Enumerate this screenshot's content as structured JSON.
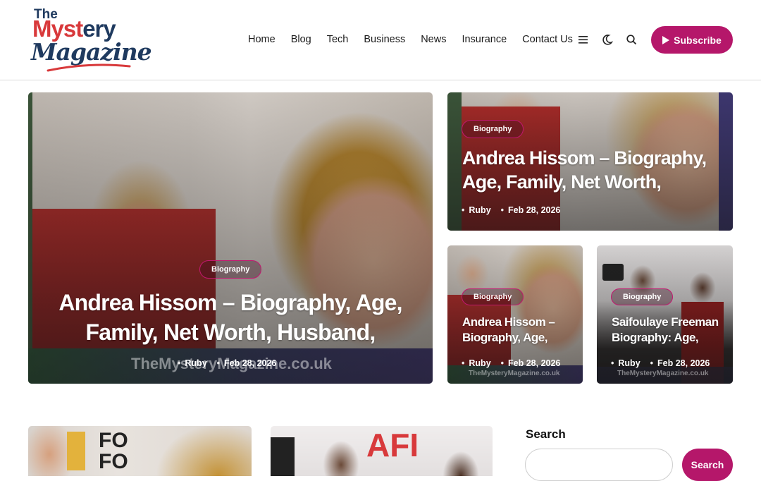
{
  "brand": {
    "logo_the": "The",
    "logo_mystery_red": "Myst",
    "logo_mystery_blue": "ery",
    "logo_magazine": "Magazine"
  },
  "nav": {
    "items": [
      "Home",
      "Blog",
      "Tech",
      "Business",
      "News",
      "Insurance",
      "Contact Us"
    ]
  },
  "header_icons": [
    "menu-icon",
    "moon-icon",
    "search-icon"
  ],
  "subscribe": {
    "label": "Subscribe",
    "color": "#b5176a"
  },
  "featured": {
    "main": {
      "category": "Biography",
      "title_line1": "Andrea Hissom – Biography, Age,",
      "title_line2": "Family, Net Worth, Husband,",
      "author": "Ruby",
      "date": "Feb 28, 2026",
      "watermark": "TheMysteryMagazine.co.uk"
    },
    "top_right": {
      "category": "Biography",
      "title_line1": "Andrea Hissom – Biography,",
      "title_line2": "Age, Family, Net Worth,",
      "author": "Ruby",
      "date": "Feb 28, 2026"
    },
    "small_left": {
      "category": "Biography",
      "title_line1": "Andrea Hissom –",
      "title_line2": "Biography, Age,",
      "author": "Ruby",
      "date": "Feb 28, 2026",
      "watermark": "TheMysteryMagazine.co.uk"
    },
    "small_right": {
      "category": "Biography",
      "title_line1": "Saifoulaye Freeman",
      "title_line2": "Biography: Age,",
      "author": "Ruby",
      "date": "Feb 28, 2026",
      "watermark": "TheMysteryMagazine.co.uk"
    }
  },
  "sidebar": {
    "search_title": "Search",
    "search_placeholder": "",
    "search_button": "Search"
  },
  "colors": {
    "accent": "#b5176a",
    "logo_red": "#d8393b",
    "logo_navy": "#1f3a5f"
  }
}
